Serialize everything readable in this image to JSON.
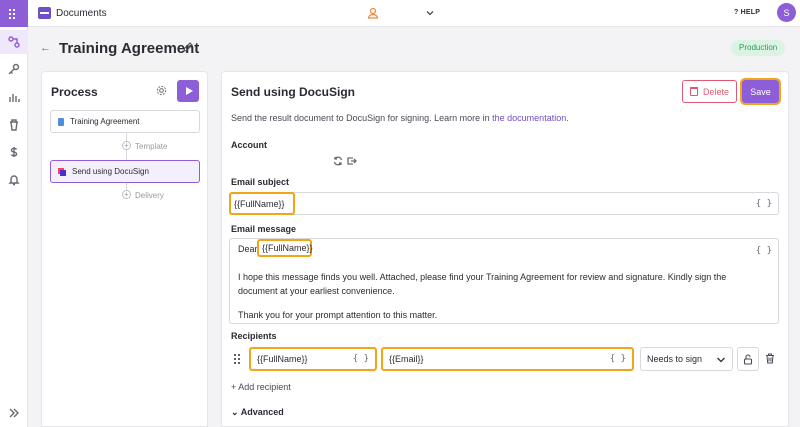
{
  "topbar": {
    "app_name": "Documents",
    "help_label": "HELP",
    "avatar_initial": "S"
  },
  "page": {
    "title": "Training Agreement",
    "environment_badge": "Production"
  },
  "process": {
    "title": "Process",
    "steps": [
      {
        "label": "Training Agreement"
      },
      {
        "label": "Send using DocuSign"
      }
    ],
    "nodes": [
      {
        "label": "Template"
      },
      {
        "label": "Delivery"
      }
    ]
  },
  "main": {
    "title": "Send using DocuSign",
    "delete_label": "Delete",
    "save_label": "Save",
    "description_prefix": "Send the result document to DocuSign for signing. Learn more in ",
    "description_link": "the documentation.",
    "account_label": "Account",
    "email_subject_label": "Email subject",
    "email_subject_value": "{{FullName}}",
    "email_message_label": "Email message",
    "email_message": {
      "greeting": "Dear",
      "token": "{{FullName}}",
      "line1": "I hope this message finds you well. Attached, please find your Training Agreement for review and signature. Kindly sign the document at your earliest convenience.",
      "line2": "Thank you for your prompt attention to this matter."
    },
    "recipients_label": "Recipients",
    "recipient": {
      "name": "{{FullName}}",
      "email": "{{Email}}",
      "action": "Needs to sign"
    },
    "add_recipient_label": "+ Add recipient",
    "advanced_label": "Advanced",
    "var_button": "{ }"
  },
  "colors": {
    "accent": "#8d5ed7",
    "highlight": "#f2a516",
    "danger": "#e05a76",
    "success_bg": "#dbf3e3"
  },
  "icons": {
    "rail": [
      "apps-icon",
      "flow-icon",
      "key-icon",
      "chart-icon",
      "trash-icon",
      "dollar-icon",
      "bell-icon",
      "expand-icon"
    ]
  }
}
